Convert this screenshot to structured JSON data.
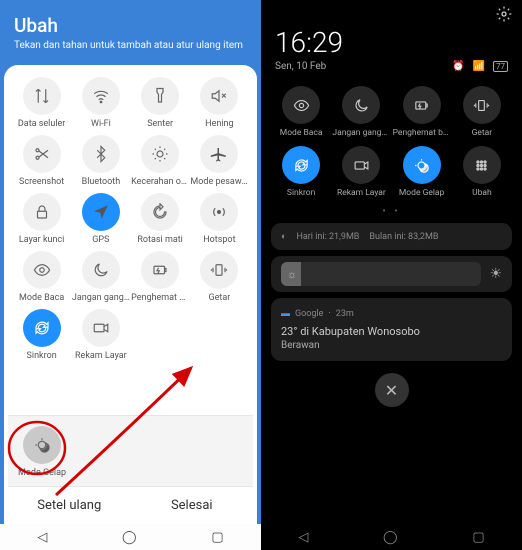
{
  "left": {
    "title": "Ubah",
    "subtitle": "Tekan dan tahan untuk tambah atau atur ulang item",
    "tiles": [
      {
        "label": "Data seluler",
        "icon": "arrows"
      },
      {
        "label": "Wi-Fi",
        "icon": "wifi"
      },
      {
        "label": "Senter",
        "icon": "torch"
      },
      {
        "label": "Hening",
        "icon": "mute"
      },
      {
        "label": "Screenshot",
        "icon": "scissors"
      },
      {
        "label": "Bluetooth",
        "icon": "bt"
      },
      {
        "label": "Kecerahan otom",
        "icon": "brightness"
      },
      {
        "label": "Mode pesawat",
        "icon": "plane"
      },
      {
        "label": "Layar kunci",
        "icon": "lock"
      },
      {
        "label": "GPS",
        "icon": "gps",
        "on": true
      },
      {
        "label": "Rotasi mati",
        "icon": "rotate"
      },
      {
        "label": "Hotspot",
        "icon": "hotspot"
      },
      {
        "label": "Mode Baca",
        "icon": "eye"
      },
      {
        "label": "Jangan ganggu",
        "icon": "moon"
      },
      {
        "label": "Penghemat baterai",
        "icon": "battery"
      },
      {
        "label": "Getar",
        "icon": "vibe"
      },
      {
        "label": "Sinkron",
        "icon": "sync",
        "on": true
      },
      {
        "label": "Rekam Layar",
        "icon": "record"
      }
    ],
    "extra": {
      "label": "Mode Gelap",
      "icon": "darkmode"
    },
    "reset": "Setel ulang",
    "done": "Selesai"
  },
  "right": {
    "time": "16:29",
    "date": "Sen, 10 Feb",
    "battery": "77",
    "tiles": [
      {
        "label": "Mode Baca",
        "icon": "eye"
      },
      {
        "label": "Jangan ganggu",
        "icon": "moon"
      },
      {
        "label": "Penghemat baterai",
        "icon": "battery"
      },
      {
        "label": "Getar",
        "icon": "vibe"
      },
      {
        "label": "Sinkron",
        "icon": "sync",
        "on": true
      },
      {
        "label": "Rekam Layar",
        "icon": "record"
      },
      {
        "label": "Mode Gelap",
        "icon": "darkmode",
        "on": true
      },
      {
        "label": "Ubah",
        "icon": "grid"
      }
    ],
    "usage_day_label": "Hari ini:",
    "usage_day": "21,9MB",
    "usage_month_label": "Bulan ini:",
    "usage_month": "83,2MB",
    "notif_app": "Google",
    "notif_time": "23m",
    "notif_title": "23° di Kabupaten Wonosobo",
    "notif_sub": "Berawan"
  }
}
